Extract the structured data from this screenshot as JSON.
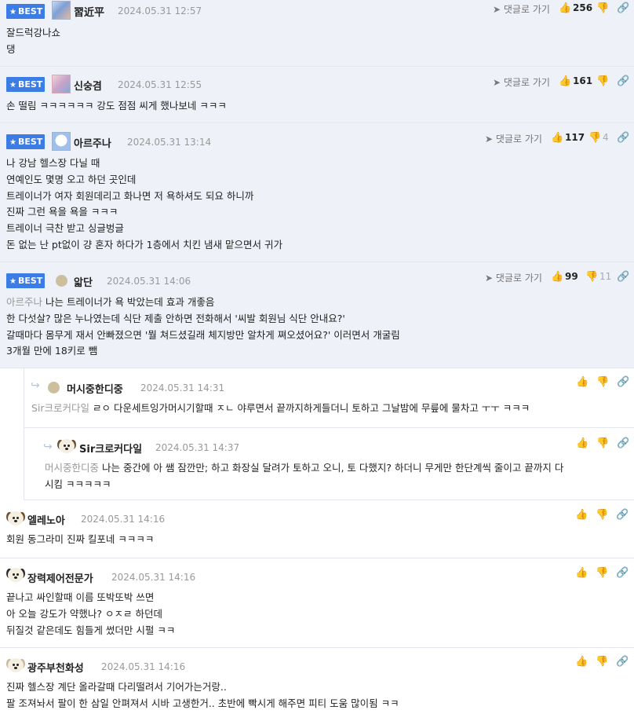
{
  "best_label": "BEST",
  "goto_label": "댓글로 가기",
  "comments": [
    {
      "nick": "習近平",
      "date": "2024.05.31 12:57",
      "likes": "256",
      "dislikes": "",
      "lines": [
        "잘드럭강나쇼",
        "댕"
      ]
    },
    {
      "nick": "신숭겸",
      "date": "2024.05.31 12:55",
      "likes": "161",
      "dislikes": "",
      "lines": [
        "손 떨림 ㅋㅋㅋㅋㅋㅋ 강도 점점 씨게 했나보네 ㅋㅋㅋ"
      ]
    },
    {
      "nick": "아르주나",
      "date": "2024.05.31 13:14",
      "likes": "117",
      "dislikes": "4",
      "lines": [
        "나 강남 헬스장 다닐 때",
        "연예인도 몇명 오고 하던 곳인데",
        "트레이너가 여자 회원데리고 화나면 저 욕하셔도 되요 하니까",
        "진짜 그런 욕을 욕을 ㅋㅋㅋ",
        "트레이너 극찬 받고 싱글벙글",
        "돈 없는 난 pt없이 걍 혼자 하다가 1층에서 치킨 냄새 맡으면서 귀가"
      ]
    },
    {
      "nick": "앏단",
      "date": "2024.05.31 14:06",
      "likes": "99",
      "dislikes": "11",
      "mention": "아르주나",
      "first": "나는 트레이너가 욕 박았는데 효과 개좋음",
      "lines": [
        "한 다섯살? 많은 누나였는데 식단 제출 안하면 전화해서 '씨발 회원님 식단 안내요?'",
        "갈때마다 몸무게 재서 안빠졌으면 '뭘 쳐드셨길래 체지방만 알차게 쪄오셨어요?' 이러면서 개굴림",
        "3개월 만에 18키로 뺌"
      ]
    },
    {
      "nick": "머시중한디중",
      "date": "2024.05.31 14:31",
      "mention": "Sir크로커다일",
      "first": "ㄹㅇ 다운세트잉가머시기할때 ㅈㄴ 야루면서 끝까지하게들더니 토하고 그날밤에 무릎에 물차고 ㅜㅜ ㅋㅋㅋ"
    },
    {
      "nick": "Sir크로커다일",
      "date": "2024.05.31 14:37",
      "mention": "머시중한디중",
      "first": "나는 중간에 아 쌤 잠깐만; 하고 화장실 달려가 토하고 오니, 토 다했지? 하더니 무게만 한단계씩 줄이고 끝까지 다",
      "lines": [
        "시킴 ㅋㅋㅋㅋㅋ"
      ]
    },
    {
      "nick": "엘레노아",
      "date": "2024.05.31 14:16",
      "lines": [
        "회원 동그라미 진짜 킬포네 ㅋㅋㅋㅋ"
      ]
    },
    {
      "nick": "장력제어전문가",
      "date": "2024.05.31 14:16",
      "lines": [
        "끝나고 싸인할때 이름 또박또박 쓰면",
        "아 오늘 강도가 약했나? ㅇㅈㄹ 하던데",
        "뒤질것 같은데도 힘들게 썼더만 시펄 ㅋㅋ"
      ]
    },
    {
      "nick": "광주부천화성",
      "date": "2024.05.31 14:16",
      "lines": [
        "진짜 헬스장 계단 올라갈때 다리떨려서 기어가는거랑..",
        "팔 조져놔서 팔이 한 삼일 안펴져서 시바 고생한거.. 초반에 빡시게 해주면 피티 도움 많이됨 ㅋㅋ"
      ]
    }
  ]
}
